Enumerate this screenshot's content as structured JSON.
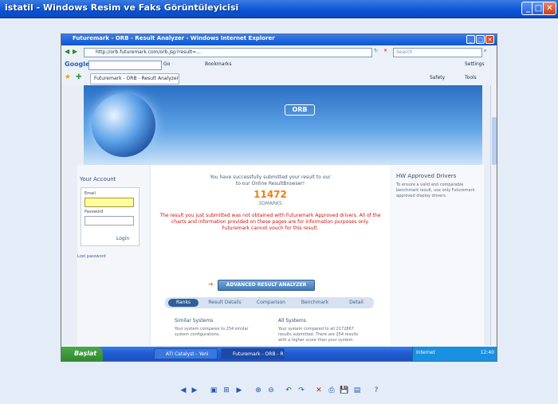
{
  "viewer": {
    "title": "istatil - Windows Resim ve Faks Görüntüleyicisi",
    "tools": [
      "◀",
      "▶",
      "▣",
      "⊞",
      "▶",
      "⊕",
      "⊖",
      "↶",
      "↷",
      "✕",
      "⎙",
      "💾",
      "▤",
      "?"
    ]
  },
  "browser": {
    "title": "Futuremark - ORB - Result Analyzer - Windows Internet Explorer",
    "address": "http://orb.futuremark.com/orb.jsp?result=...",
    "search_placeholder": "Search",
    "google_label": "Google",
    "go_label": "Go",
    "bookmarks_label": "Bookmarks",
    "settings_label": "Settings",
    "tab_label": "Futuremark - ORB - Result Analyzer",
    "safety_label": "Safety",
    "tools_label": "Tools"
  },
  "page": {
    "logo": "ORB",
    "account": {
      "title": "Your Account",
      "email_label": "Email",
      "password_label": "Password",
      "login": "Login",
      "lost": "Lost password"
    },
    "main": {
      "intro_1": "You have successfully submitted your result to our",
      "intro_2": "to our Online ResultBrowser!",
      "score": "11472",
      "unit": "3DMARKS",
      "warning": "The result you just submitted was not obtained with Futuremark Approved drivers. All of the charts and information provided on these pages are for information purposes only. Futuremark cannot vouch for this result.",
      "advanced": "ADVANCED RESULT ANALYZER",
      "tabs": [
        "Ranks",
        "Result Details",
        "Comparison",
        "Benchmark",
        "Detail"
      ],
      "col1_title": "Similar Systems",
      "col1_text": "Your system compares to 254 similar system configurations.",
      "col2_title": "All Systems",
      "col2_text": "Your system compared to all 2172867 results submitted. There are 254 results with a higher score than your system."
    },
    "right": {
      "title": "HW Approved Drivers",
      "text": "To ensure a valid and comparable benchmark result, use only Futuremark approved display drivers."
    }
  },
  "taskbar": {
    "start": "Başlat",
    "tasks": [
      "ATI Catalyst - Yeni",
      "Futuremark - ORB - R..."
    ],
    "status_text": "Internet",
    "clock": "12:40"
  }
}
